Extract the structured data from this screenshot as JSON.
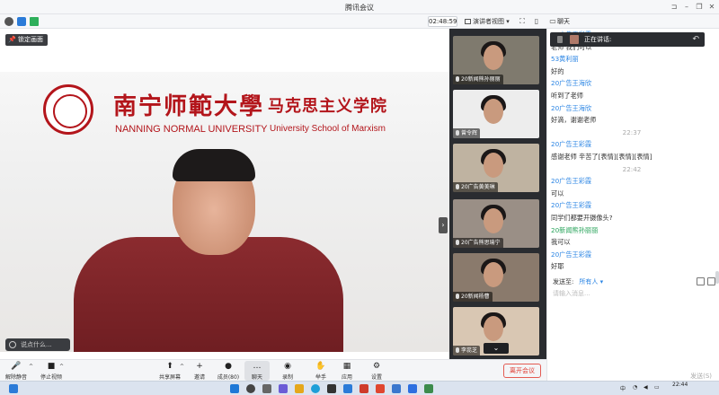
{
  "window": {
    "title": "腾讯会议",
    "controls": [
      "pin-icon",
      "minimize-icon",
      "restore-icon",
      "close-icon"
    ]
  },
  "infobar": {
    "timer": "02:48:59",
    "view_label": "演讲者视图",
    "chat_tab_label": "聊天"
  },
  "video": {
    "pin_label": "锁定画面",
    "banner_cn": "南宁师範大學",
    "banner_cn_school": "马克思主义学院",
    "banner_en": "NANNING NORMAL UNIVERSITY",
    "banner_en_school": "University School of Marxism",
    "chat_placeholder": "说点什么...",
    "accent": "#b3151b"
  },
  "gallery": {
    "tiles": [
      {
        "name": "20新闻熊孙丽丽",
        "bg": "#7f7a6e"
      },
      {
        "name": "曾令辉",
        "bg": "#ededed"
      },
      {
        "name": "20广告黄美琳",
        "bg": "#bfb3a1"
      },
      {
        "name": "20广告熊思瑜宁",
        "bg": "#9a8f86"
      },
      {
        "name": "20新闻杨曹",
        "bg": "#8a7a6c"
      },
      {
        "name": "李蕊芝",
        "bg": "#d9c7b3"
      }
    ]
  },
  "chat": {
    "speaking_label": "正在讲话:",
    "messages": [
      {
        "kind": "sender",
        "text": "20广告王彩霞"
      },
      {
        "kind": "text",
        "text": "老师 我们可以"
      },
      {
        "kind": "sender",
        "text": "53黄利丽"
      },
      {
        "kind": "text",
        "text": "好的"
      },
      {
        "kind": "sender",
        "text": "20广告王海欣"
      },
      {
        "kind": "text",
        "text": "听到了老师"
      },
      {
        "kind": "sender",
        "text": "20广告王海欣"
      },
      {
        "kind": "text",
        "text": "好滴，谢谢老师"
      },
      {
        "kind": "time",
        "text": "22:37"
      },
      {
        "kind": "sender",
        "text": "20广告王彩霞"
      },
      {
        "kind": "text",
        "text": "感谢老师 辛苦了[表情][表情][表情]"
      },
      {
        "kind": "time",
        "text": "22:42"
      },
      {
        "kind": "sender",
        "text": "20广告王彩霞"
      },
      {
        "kind": "text",
        "text": "可以"
      },
      {
        "kind": "sender",
        "text": "20广告王彩霞"
      },
      {
        "kind": "text",
        "text": "同学们都要开摄像头?"
      },
      {
        "kind": "sender-green",
        "text": "20新闻熊孙丽丽"
      },
      {
        "kind": "text",
        "text": "我可以"
      },
      {
        "kind": "sender",
        "text": "20广告王彩霞"
      },
      {
        "kind": "text",
        "text": "好耶"
      }
    ],
    "send_to_label": "发送至:",
    "send_to_value": "所有人",
    "input_placeholder": "请输入消息...",
    "send_button": "发送(S)"
  },
  "controls": {
    "items": [
      {
        "name": "mute-button",
        "icon": "microphone-icon",
        "glyph": "🎤",
        "label": "解除静音"
      },
      {
        "name": "stop-video-button",
        "icon": "camera-icon",
        "glyph": "■",
        "label": "停止视频"
      },
      {
        "name": "share-screen-button",
        "icon": "share-screen-icon",
        "glyph": "⬆",
        "label": "共享屏幕"
      },
      {
        "name": "invite-button",
        "icon": "invite-icon",
        "glyph": "+",
        "label": "邀请"
      },
      {
        "name": "members-button",
        "icon": "members-icon",
        "glyph": "●",
        "label": "成员(80)"
      },
      {
        "name": "chat-button",
        "icon": "chat-icon",
        "glyph": "…",
        "label": "聊天"
      },
      {
        "name": "record-button",
        "icon": "record-icon",
        "glyph": "◉",
        "label": "录制"
      },
      {
        "name": "raise-hand-button",
        "icon": "hand-icon",
        "glyph": "✋",
        "label": "举手"
      },
      {
        "name": "apps-button",
        "icon": "apps-icon",
        "glyph": "▦",
        "label": "应用"
      },
      {
        "name": "settings-button",
        "icon": "gear-icon",
        "glyph": "⚙",
        "label": "设置"
      }
    ],
    "leave_label": "离开会议"
  },
  "taskbar": {
    "lang": "中",
    "time": "22:44"
  }
}
